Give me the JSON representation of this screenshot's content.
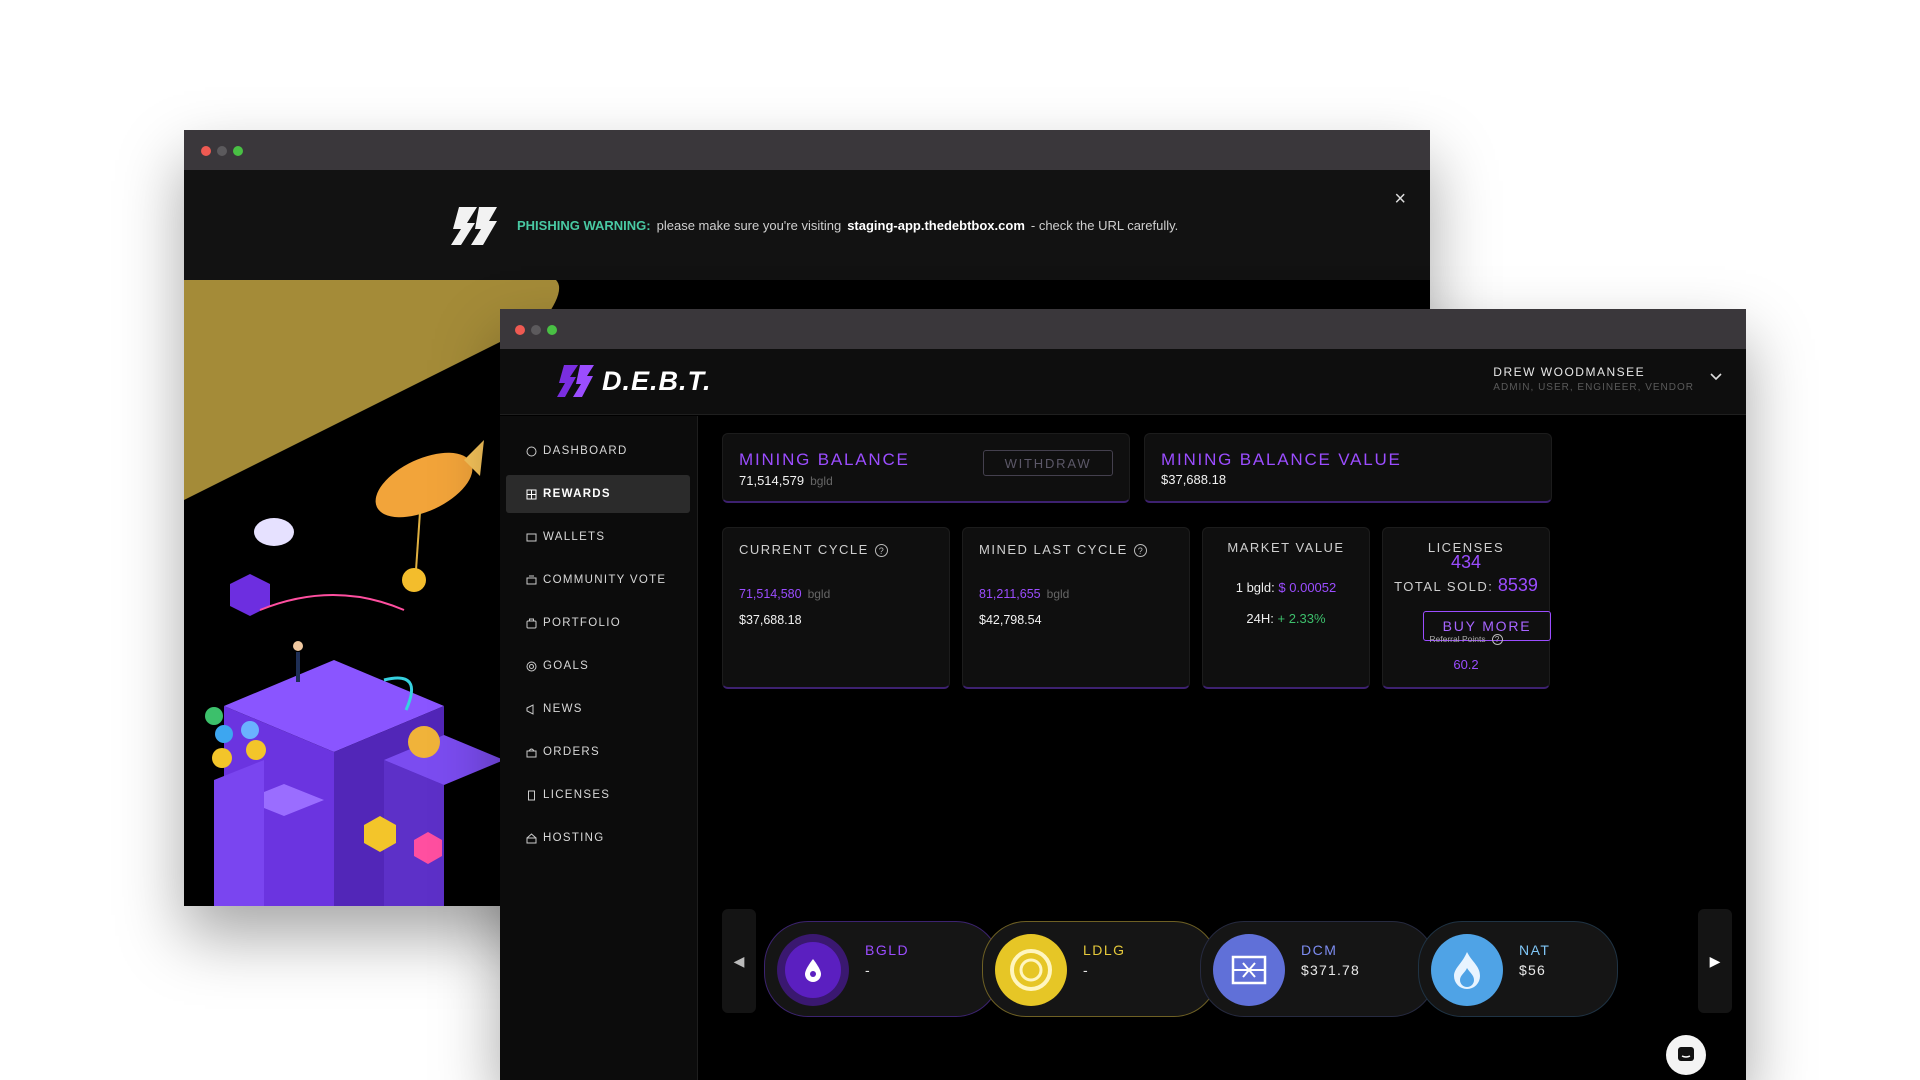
{
  "back_window": {
    "warning": {
      "label": "PHISHING WARNING:",
      "text_before": "please make sure you're visiting",
      "url": "staging-app.thedebtbox.com",
      "text_after": "- check the URL carefully.",
      "close": "×"
    }
  },
  "header": {
    "brand": "D.E.B.T.",
    "user_name": "DREW WOODMANSEE",
    "user_roles": "ADMIN, USER, ENGINEER, VENDOR"
  },
  "sidebar": {
    "items": [
      {
        "label": "DASHBOARD",
        "icon": "dashboard-icon"
      },
      {
        "label": "REWARDS",
        "icon": "rewards-icon"
      },
      {
        "label": "WALLETS",
        "icon": "wallet-icon"
      },
      {
        "label": "COMMUNITY VOTE",
        "icon": "vote-icon"
      },
      {
        "label": "PORTFOLIO",
        "icon": "portfolio-icon"
      },
      {
        "label": "GOALS",
        "icon": "goals-icon"
      },
      {
        "label": "NEWS",
        "icon": "news-icon"
      },
      {
        "label": "ORDERS",
        "icon": "orders-icon"
      },
      {
        "label": "LICENSES",
        "icon": "licenses-icon"
      },
      {
        "label": "HOSTING",
        "icon": "hosting-icon"
      }
    ],
    "active": "REWARDS"
  },
  "mining_balance": {
    "title": "MINING BALANCE",
    "amount": "71,514,579",
    "unit": "bgld",
    "withdraw_label": "WITHDRAW"
  },
  "mining_balance_value": {
    "title": "MINING BALANCE VALUE",
    "amount": "$37,688.18"
  },
  "current_cycle": {
    "title": "CURRENT CYCLE",
    "amount": "71,514,580",
    "unit": "bgld",
    "value": "$37,688.18"
  },
  "mined_last_cycle": {
    "title": "MINED LAST CYCLE",
    "amount": "81,211,655",
    "unit": "bgld",
    "value": "$42,798.54"
  },
  "market_value": {
    "title": "MARKET VALUE",
    "price_label": "1 bgld:",
    "price": "$ 0.00052",
    "change_label": "24H:",
    "change": "+ 2.33%"
  },
  "licenses": {
    "title": "LICENSES",
    "count": "434",
    "total_sold_label": "TOTAL SOLD:",
    "total_sold": "8539",
    "buy_more_label": "BUY MORE",
    "referral_label": "Referral Points",
    "referral_points": "60.2"
  },
  "tokens": [
    {
      "name": "BGLD",
      "value": "-",
      "name_color": "#9b4dff",
      "ring_color": "#7a2ee0",
      "icon": "drop-icon"
    },
    {
      "name": "LDLG",
      "value": "-",
      "name_color": "#e4c83b",
      "ring_color": "#e6c626",
      "icon": "coin-icon"
    },
    {
      "name": "DCM",
      "value": "$371.78",
      "name_color": "#7d8cf0",
      "ring_color": "#6070d8",
      "icon": "mine-icon"
    },
    {
      "name": "NAT",
      "value": "$56",
      "name_color": "#7fc5f5",
      "ring_color": "#4fa3e6",
      "icon": "flame-icon"
    }
  ],
  "colors": {
    "accent_purple": "#9b4dff",
    "positive_green": "#3dbf6c",
    "warning_green": "#49c9a3"
  }
}
